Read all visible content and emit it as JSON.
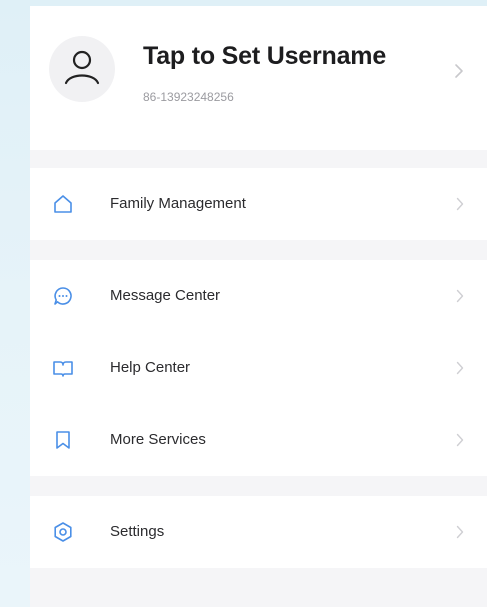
{
  "profile": {
    "username": "Tap to Set Username",
    "phone": "86-13923248256"
  },
  "sections": [
    {
      "items": [
        {
          "label": "Family Management",
          "icon": "home-icon"
        }
      ]
    },
    {
      "items": [
        {
          "label": "Message Center",
          "icon": "message-icon"
        },
        {
          "label": "Help Center",
          "icon": "book-icon"
        },
        {
          "label": "More Services",
          "icon": "bookmark-icon"
        }
      ]
    },
    {
      "items": [
        {
          "label": "Settings",
          "icon": "settings-icon"
        }
      ]
    }
  ],
  "colors": {
    "accent": "#4a8fe7",
    "page_background": "#f5f5f7",
    "outer_background": "#e3f2f8"
  }
}
